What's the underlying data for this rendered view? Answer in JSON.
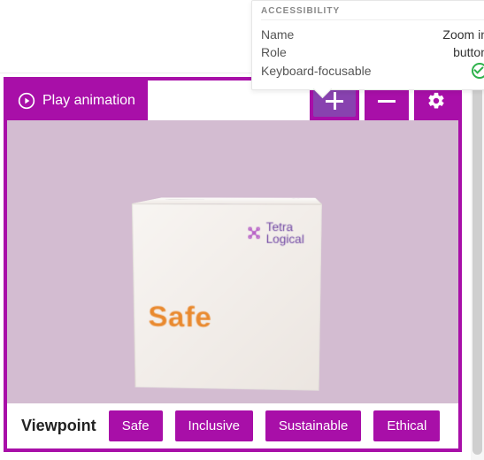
{
  "a11y": {
    "heading": "ACCESSIBILITY",
    "rows": {
      "name_label": "Name",
      "name_value": "Zoom in",
      "role_label": "Role",
      "role_value": "button",
      "focus_label": "Keyboard-focusable"
    }
  },
  "toolbar": {
    "play_label": "Play animation",
    "buttons": {
      "zoom_in": "Zoom in",
      "zoom_out": "Zoom out",
      "settings": "Settings"
    }
  },
  "cube": {
    "brand_line1": "Tetra",
    "brand_line2": "Logical",
    "front_word": "Safe"
  },
  "viewpoint": {
    "label": "Viewpoint",
    "options": [
      "Safe",
      "Inclusive",
      "Sustainable",
      "Ethical"
    ]
  },
  "colors": {
    "accent": "#a80fa8",
    "cube_word": "#e9892e"
  }
}
